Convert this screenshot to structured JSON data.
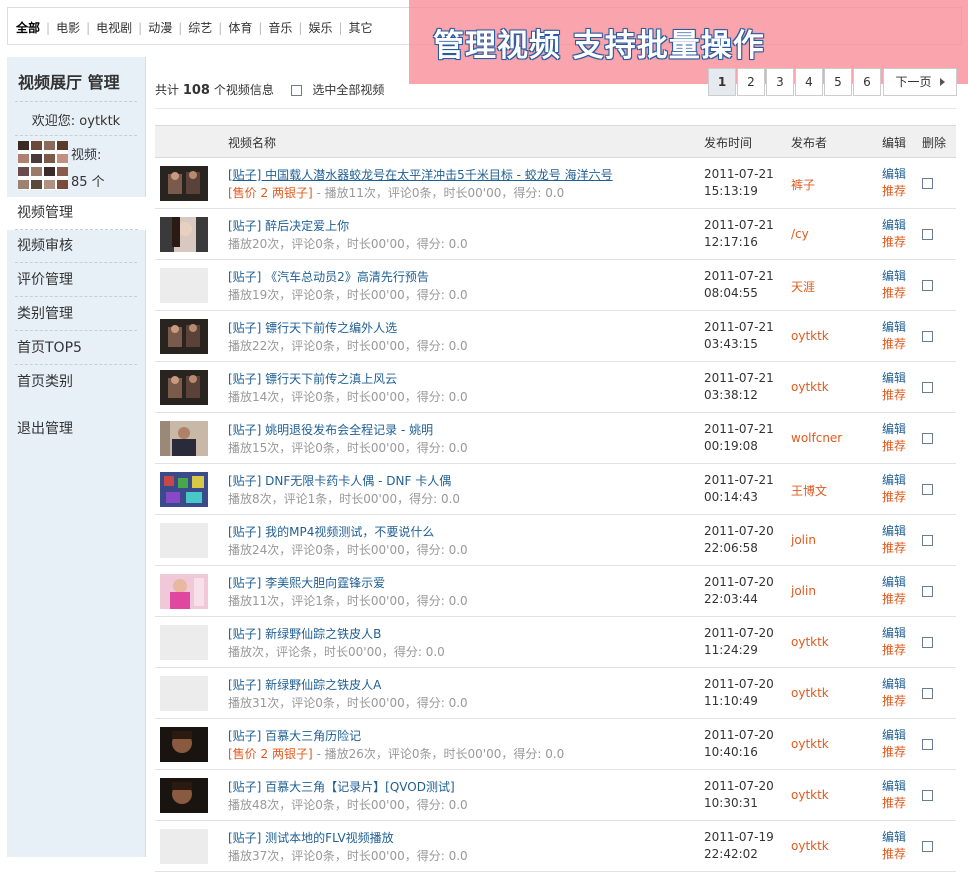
{
  "categories": [
    {
      "label": "全部",
      "active": true
    },
    {
      "label": "电影"
    },
    {
      "label": "电视剧"
    },
    {
      "label": "动漫"
    },
    {
      "label": "综艺"
    },
    {
      "label": "体育"
    },
    {
      "label": "音乐"
    },
    {
      "label": "娱乐"
    },
    {
      "label": "其它"
    }
  ],
  "promo_text": "管理视频 支持批量操作",
  "sidebar": {
    "title": "视频展厅 管理",
    "welcome": "欢迎您: oytktk",
    "video_label": "视频:",
    "video_count": "85 个",
    "menu": [
      {
        "label": "视频管理",
        "active": true
      },
      {
        "label": "视频审核"
      },
      {
        "label": "评价管理"
      },
      {
        "label": "类别管理"
      },
      {
        "label": "首页TOP5"
      },
      {
        "label": "首页类别"
      },
      {
        "label": "退出管理"
      }
    ]
  },
  "summary": {
    "prefix": "共计",
    "count": "108",
    "suffix": "个视频信息",
    "select_all": "选中全部视频"
  },
  "pager": {
    "pages": [
      "1",
      "2",
      "3",
      "4",
      "5",
      "6"
    ],
    "current": "1",
    "next": "下一页"
  },
  "table": {
    "headers": {
      "name": "视频名称",
      "time": "发布时间",
      "author": "发布者",
      "edit": "编辑",
      "delete": "删除"
    },
    "edit_label": "编辑",
    "recommend_label": "推荐",
    "rows": [
      {
        "title": "[贴子] 中国载人潜水器蛟龙号在太平洋冲击5千米目标 - 蛟龙号 海洋六号",
        "underline": true,
        "price": "[售价 2 两银子]",
        "meta": " - 播放11次，评论0条，时长00'00，得分: 0.0",
        "date": "2011-07-21",
        "time": "15:13:19",
        "author": "裤子",
        "thumb": "dark"
      },
      {
        "title": "[贴子] 醉后决定爱上你",
        "meta": "播放20次，评论0条，时长00'00，得分: 0.0",
        "date": "2011-07-21",
        "time": "12:17:16",
        "author": "/cy",
        "thumb": "woman"
      },
      {
        "title": "[贴子] 《汽车总动员2》高清先行预告",
        "meta": "播放19次，评论0条，时长00'00，得分: 0.0",
        "date": "2011-07-21",
        "time": "08:04:55",
        "author": "天涯",
        "thumb": "none"
      },
      {
        "title": "[贴子] 镖行天下前传之编外人选",
        "meta": "播放22次，评论0条，时长00'00，得分: 0.0",
        "date": "2011-07-21",
        "time": "03:43:15",
        "author": "oytktk",
        "thumb": "dark"
      },
      {
        "title": "[贴子] 镖行天下前传之滇上风云",
        "meta": "播放14次，评论0条，时长00'00，得分: 0.0",
        "date": "2011-07-21",
        "time": "03:38:12",
        "author": "oytktk",
        "thumb": "dark"
      },
      {
        "title": "[贴子] 姚明退役发布会全程记录 - 姚明",
        "meta": "播放15次，评论0条，时长00'00，得分: 0.0",
        "date": "2011-07-21",
        "time": "00:19:08",
        "author": "wolfcner",
        "thumb": "press"
      },
      {
        "title": "[贴子] DNF无限卡药卡人偶 - DNF 卡人偶",
        "meta": "播放8次，评论1条，时长00'00，得分: 0.0",
        "date": "2011-07-21",
        "time": "00:14:43",
        "author": "王博文",
        "thumb": "game"
      },
      {
        "title": "[贴子] 我的MP4视频测试，不要说什么",
        "meta": "播放24次，评论0条，时长00'00，得分: 0.0",
        "date": "2011-07-20",
        "time": "22:06:58",
        "author": "jolin",
        "thumb": "none"
      },
      {
        "title": "[贴子] 李美熙大胆向霆锋示爱",
        "meta": "播放11次，评论1条，时长00'00，得分: 0.0",
        "date": "2011-07-20",
        "time": "22:03:44",
        "author": "jolin",
        "thumb": "pink"
      },
      {
        "title": "[贴子] 新绿野仙踪之铁皮人B",
        "meta": "播放次，评论条，时长00'00，得分: 0.0",
        "date": "2011-07-20",
        "time": "11:24:29",
        "author": "oytktk",
        "thumb": "none"
      },
      {
        "title": "[贴子] 新绿野仙踪之铁皮人A",
        "meta": "播放31次，评论0条，时长00'00，得分: 0.0",
        "date": "2011-07-20",
        "time": "11:10:49",
        "author": "oytktk",
        "thumb": "none"
      },
      {
        "title": "[贴子] 百慕大三角历险记",
        "price": "[售价 2 两银子]",
        "meta": " - 播放26次，评论0条，时长00'00，得分: 0.0",
        "date": "2011-07-20",
        "time": "10:40:16",
        "author": "oytktk",
        "thumb": "face"
      },
      {
        "title": "[贴子] 百慕大三角【记录片】[QVOD测试]",
        "meta": "播放48次，评论0条，时长00'00，得分: 0.0",
        "date": "2011-07-20",
        "time": "10:30:31",
        "author": "oytktk",
        "thumb": "face"
      },
      {
        "title": "[贴子] 测试本地的FLV视频播放",
        "meta": "播放37次，评论0条，时长00'00，得分: 0.0",
        "date": "2011-07-19",
        "time": "22:42:02",
        "author": "oytktk",
        "thumb": "none"
      }
    ]
  },
  "colors": {
    "link": "#1f5f94",
    "accent": "#e05a1e",
    "sidebar_bg": "#e8f0f7",
    "header_bg": "#f0f0f0",
    "promo": "#f88c96"
  },
  "icons": {
    "placeholder_text": "视频截图",
    "next_arrow": "triangle-right-icon"
  }
}
